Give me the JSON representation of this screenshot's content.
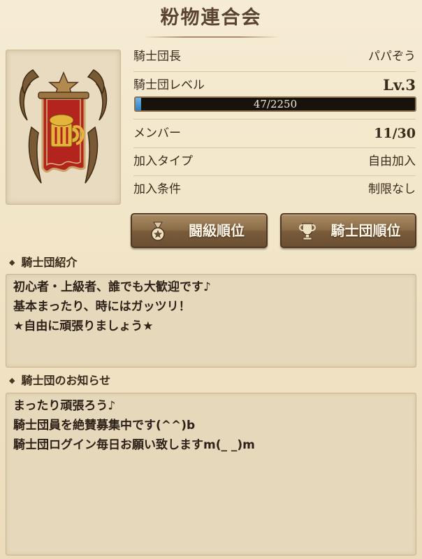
{
  "header": {
    "title": "粉物連合会"
  },
  "info": {
    "leader_label": "騎士団長",
    "leader_value": "パパぞう",
    "level_label": "騎士団レベル",
    "level_value": "Lv.3",
    "exp_text": "47/2250",
    "exp_progress": 0.021,
    "members_label": "メンバー",
    "members_value": "11/30",
    "join_type_label": "加入タイプ",
    "join_type_value": "自由加入",
    "join_cond_label": "加入条件",
    "join_cond_value": "制限なし"
  },
  "buttons": {
    "battle_rank": "闘級順位",
    "guild_rank": "騎士団順位"
  },
  "intro": {
    "heading": "騎士団紹介",
    "lines": [
      "初心者・上級者、誰でも大歓迎です♪",
      "基本まったり、時にはガッツリ！",
      "★自由に頑張りましょう★"
    ]
  },
  "notice": {
    "heading": "騎士団のお知らせ",
    "lines": [
      "まったり頑張ろう♪",
      "騎士団員を絶賛募集中です(^^)b",
      "騎士団ログイン毎日お願い致しますm(_ _)m"
    ]
  },
  "colors": {
    "banner_red": "#b2241d",
    "emblem_gold": "#e7b43b",
    "exp_blue": "#3a8ad0"
  },
  "icons": {
    "battle_rank": "medal-icon",
    "guild_rank": "trophy-icon",
    "emblem": "guild-emblem-mug"
  }
}
